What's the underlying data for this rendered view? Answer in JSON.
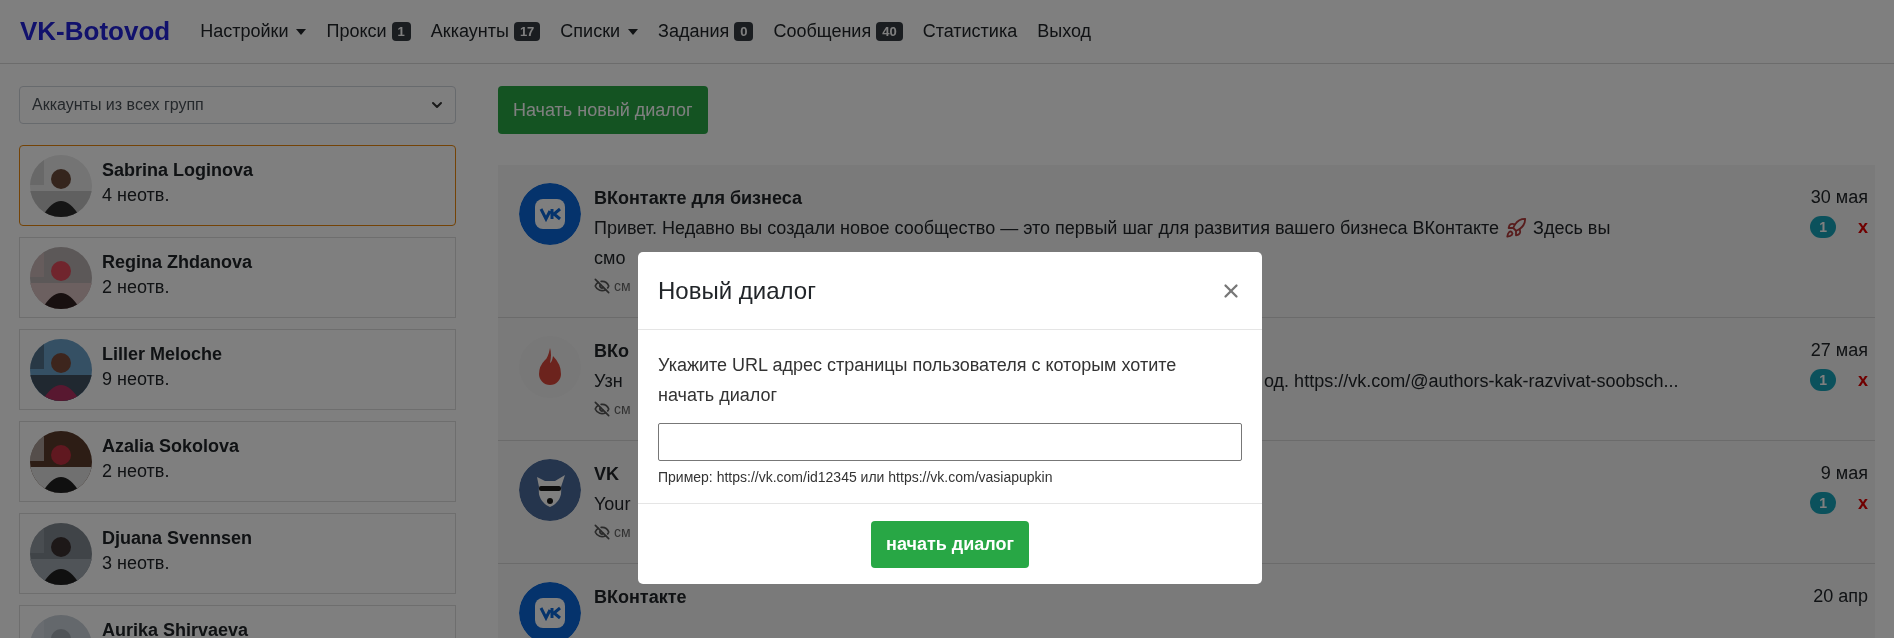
{
  "navbar": {
    "brand": "VK-Botovod",
    "items": [
      {
        "label": "Настройки",
        "kind": "dropdown"
      },
      {
        "label": "Прокси",
        "kind": "counter",
        "badge": "1"
      },
      {
        "label": "Аккаунты",
        "kind": "counter",
        "badge": "17"
      },
      {
        "label": "Списки",
        "kind": "dropdown"
      },
      {
        "label": "Задания",
        "kind": "counter",
        "badge": "0"
      },
      {
        "label": "Сообщения",
        "kind": "counter",
        "badge": "40"
      },
      {
        "label": "Статистика",
        "kind": "link"
      },
      {
        "label": "Выход",
        "kind": "link"
      }
    ]
  },
  "sidebar": {
    "group_select": {
      "value": "Аккаунты из всех групп"
    },
    "accounts": [
      {
        "name": "Sabrina Loginova",
        "unread": "4 неотв.",
        "selected": true
      },
      {
        "name": "Regina Zhdanova",
        "unread": "2 неотв.",
        "selected": false
      },
      {
        "name": "Liller Meloche",
        "unread": "9 неотв.",
        "selected": false
      },
      {
        "name": "Azalia Sokolova",
        "unread": "2 неотв.",
        "selected": false
      },
      {
        "name": "Djuana Svennsen",
        "unread": "3 неотв.",
        "selected": false
      },
      {
        "name": "Aurika Shirvaeva",
        "selected": false
      }
    ]
  },
  "new_dialog_button": "Начать новый диалог",
  "dialogs": [
    {
      "kind": "logo",
      "title": "ВКонтакте для бизнеса",
      "date": "30 мая",
      "unread": "1",
      "delete": "x",
      "message_lines": [
        [
          {
            "kind": "text",
            "text": "Привет. Недавно вы создали новое сообщество — это первый шаг для развития вашего бизнеса ВКонтакте"
          },
          {
            "kind": "emoji"
          },
          {
            "kind": "text",
            "text": "Здесь вы"
          }
        ],
        [
          {
            "kind": "text",
            "text": "смо"
          }
        ]
      ],
      "meta": "см"
    },
    {
      "kind": "flame",
      "title": "ВКо",
      "date": "27 мая",
      "unread": "1",
      "delete": "x",
      "message_lines": [
        [
          {
            "kind": "text",
            "text": "Узн"
          },
          {
            "kind": "gap"
          },
          {
            "kind": "text",
            "text": "од. https://vk.com/@authors-kak-razvivat-soobsch..."
          }
        ]
      ],
      "meta": "см"
    },
    {
      "kind": "mascot",
      "title": "VK",
      "date": "9 мая",
      "unread": "1",
      "delete": "x",
      "message_lines": [
        [
          {
            "kind": "text",
            "text": "Your"
          }
        ]
      ],
      "meta": "см"
    },
    {
      "kind": "logo",
      "title": "ВКонтакте",
      "date": "20 апр"
    }
  ],
  "modal": {
    "title": "Новый диалог",
    "prompt": "Укажите URL адрес страницы пользователя с которым хотите начать диалог",
    "hint": "Пример: https://vk.com/id12345 или https://vk.com/vasiapupkin",
    "submit": "начать диалог"
  }
}
